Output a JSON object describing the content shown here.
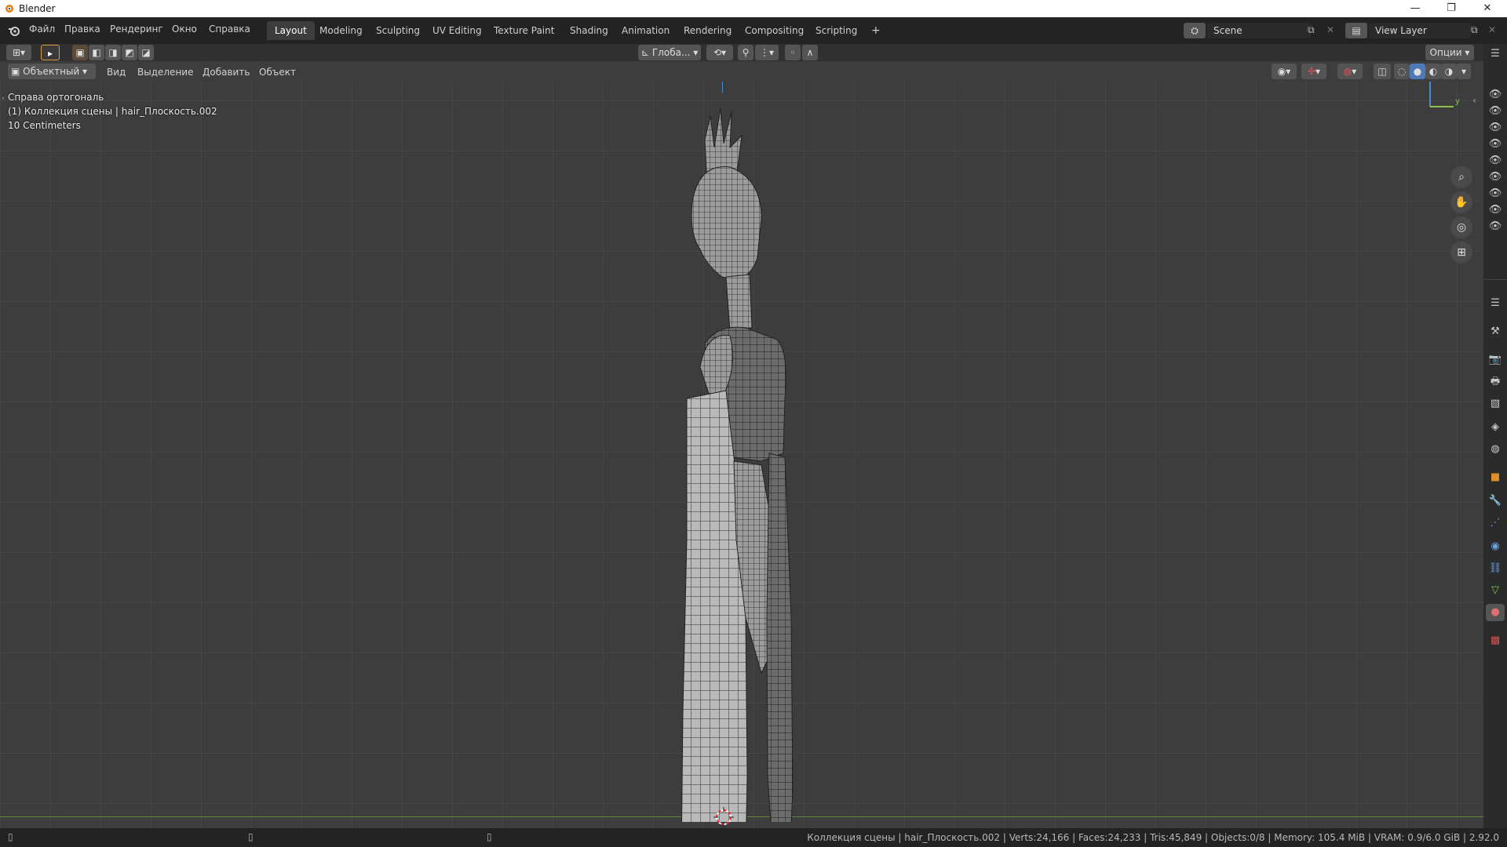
{
  "window": {
    "title": "Blender",
    "controls": [
      "—",
      "❐",
      "✕"
    ]
  },
  "menu": [
    "Файл",
    "Правка",
    "Рендеринг",
    "Окно",
    "Справка"
  ],
  "workspaces": [
    "Layout",
    "Modeling",
    "Sculpting",
    "UV Editing",
    "Texture Paint",
    "Shading",
    "Animation",
    "Rendering",
    "Compositing",
    "Scripting"
  ],
  "add_workspace": "+",
  "scene": {
    "name": "Scene"
  },
  "view_layer": {
    "name": "View Layer"
  },
  "tool_header": {
    "transform_orientation": "Глоба...",
    "options_label": "Опции"
  },
  "view_header": {
    "mode": "Объектный",
    "menus": [
      "Вид",
      "Выделение",
      "Добавить",
      "Объект"
    ]
  },
  "viewport": {
    "view_name": "Справа ортогональ",
    "collection_info": "(1) Коллекция сцены | hair_Плоскость.002",
    "scale_info": "10 Centimeters",
    "axis_label": "y"
  },
  "status": {
    "text": "Коллекция сцены | hair_Плоскость.002 | Verts:24,166 | Faces:24,233 | Tris:45,849 | Objects:0/8 | Memory: 105.4 MiB | VRAM: 0.9/6.0 GiB | 2.92.0"
  },
  "colors": {
    "accent": "#e09a3a",
    "active_tab": "#3d3d3d",
    "y_axis": "#8bc34a",
    "z_axis": "#4a8bd6",
    "horizon": "#5e8a3a"
  }
}
